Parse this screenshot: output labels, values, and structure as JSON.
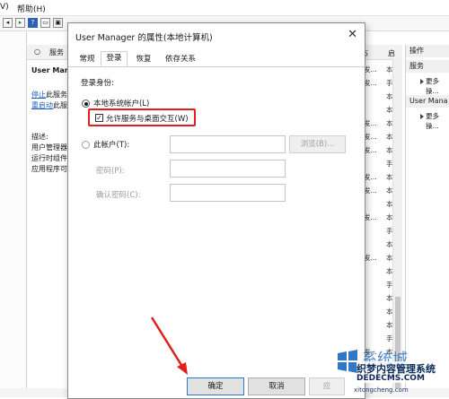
{
  "menu": {
    "left_fragment": "V)",
    "help": "帮助(H)"
  },
  "left_panel": {
    "header_fragment": "服务",
    "title_fragment": "User Man",
    "links": [
      "停止",
      "重启动"
    ],
    "link_suffixes": [
      "此服务",
      "此服"
    ],
    "desc_label": "描述:",
    "desc_lines": [
      "用户管理器",
      "运行时组件",
      "应用程序可"
    ]
  },
  "column_header": {
    "status": "态",
    "start": "启"
  },
  "rows": [
    [
      "发...",
      "本"
    ],
    [
      "发...",
      "手"
    ],
    [
      "",
      "本"
    ],
    [
      "",
      "本"
    ],
    [
      "发...",
      "本"
    ],
    [
      "发...",
      "本"
    ],
    [
      "发...",
      "本"
    ],
    [
      "",
      "手"
    ],
    [
      "发...",
      "本"
    ],
    [
      "发...",
      "本"
    ],
    [
      "",
      "本"
    ],
    [
      "发...",
      "本"
    ],
    [
      "",
      "手"
    ],
    [
      "",
      "本"
    ],
    [
      "发...",
      "本"
    ],
    [
      "",
      "本"
    ],
    [
      "",
      "手"
    ],
    [
      "",
      "本"
    ],
    [
      "",
      "本"
    ],
    [
      "",
      "本"
    ],
    [
      "",
      "手"
    ],
    [
      "发...",
      "本"
    ],
    [
      "",
      "本"
    ],
    [
      "",
      "手"
    ]
  ],
  "actions": {
    "header": "操作",
    "section1": "服务",
    "section1_item": "更多操...",
    "section2": "User Mana",
    "section2_item": "更多操..."
  },
  "dialog": {
    "title": "User Manager 的属性(本地计算机)",
    "close": "✕",
    "tabs": [
      "常规",
      "登录",
      "恢复",
      "依存关系"
    ],
    "active_tab": 1,
    "logon_as": "登录身份:",
    "local_system": "本地系统帐户(L)",
    "allow_desktop": "允许服务与桌面交互(W)",
    "this_account": "此帐户(T):",
    "browse": "浏览(B)...",
    "password": "密码(P):",
    "confirm_password": "确认密码(C):",
    "ok": "确定",
    "cancel": "取消",
    "apply": "应"
  },
  "watermark": {
    "line1": "织梦内容管理系统",
    "line2": "DEDECMS.COM",
    "big": "系统城",
    "sub": "xitongcheng.com"
  },
  "colors": {
    "highlight": "#e0201c",
    "arrow": "#e0201c",
    "link": "#1f5fbf",
    "accent": "#2b78d0"
  }
}
